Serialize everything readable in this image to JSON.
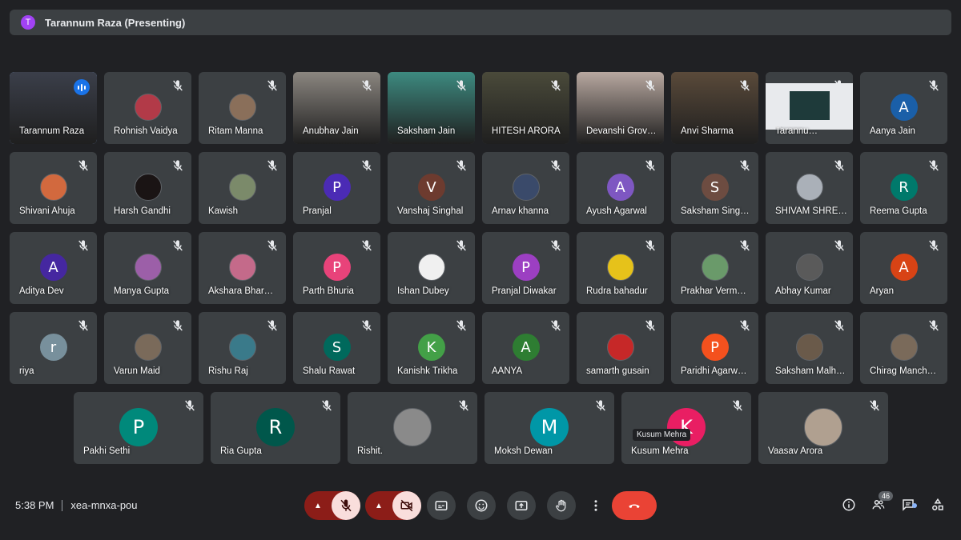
{
  "presenter": {
    "initial": "T",
    "label": "Tarannum Raza (Presenting)"
  },
  "rows": [
    [
      {
        "name": "Tarannum Raza",
        "type": "video",
        "bg": "#3b3f4a",
        "speaking": true
      },
      {
        "name": "Rohnish Vaidya",
        "type": "photo",
        "bg": "#b23a48"
      },
      {
        "name": "Ritam Manna",
        "type": "photo",
        "bg": "#8a6f5a"
      },
      {
        "name": "Anubhav Jain",
        "type": "video",
        "bg": "#8b8680"
      },
      {
        "name": "Saksham Jain",
        "type": "video",
        "bg": "#3d8a80"
      },
      {
        "name": "HITESH ARORA",
        "type": "video",
        "bg": "#4a4a3a"
      },
      {
        "name": "Devanshi Grov…",
        "type": "video",
        "bg": "#b8a8a0"
      },
      {
        "name": "Anvi Sharma",
        "type": "video",
        "bg": "#5a4a3a"
      },
      {
        "name": "Tarannu…",
        "type": "screen",
        "bg": "#e8eaed"
      },
      {
        "name": "Aanya Jain",
        "type": "initial",
        "initial": "A",
        "bg": "#1a5fa8"
      }
    ],
    [
      {
        "name": "Shivani Ahuja",
        "type": "photo",
        "bg": "#d2693e"
      },
      {
        "name": "Harsh Gandhi",
        "type": "photo",
        "bg": "#1a1414"
      },
      {
        "name": "Kawish",
        "type": "photo",
        "bg": "#7b8a6a"
      },
      {
        "name": "Pranjal",
        "type": "initial",
        "initial": "P",
        "bg": "#4b2bb5"
      },
      {
        "name": "Vanshaj Singhal",
        "type": "initial",
        "initial": "V",
        "bg": "#6d3b2f"
      },
      {
        "name": "Arnav khanna",
        "type": "photo",
        "bg": "#3a4a6a"
      },
      {
        "name": "Ayush Agarwal",
        "type": "initial",
        "initial": "A",
        "bg": "#7e57c2"
      },
      {
        "name": "Saksham Sing…",
        "type": "initial",
        "initial": "S",
        "bg": "#6d4c41"
      },
      {
        "name": "SHIVAM SHRE…",
        "type": "photo",
        "bg": "#aab0b8"
      },
      {
        "name": "Reema Gupta",
        "type": "initial",
        "initial": "R",
        "bg": "#00796b"
      }
    ],
    [
      {
        "name": "Aditya Dev",
        "type": "initial",
        "initial": "A",
        "bg": "#4527a0"
      },
      {
        "name": "Manya Gupta",
        "type": "photo",
        "bg": "#9c5fa8"
      },
      {
        "name": "Akshara Bhar…",
        "type": "photo",
        "bg": "#c46a8a"
      },
      {
        "name": "Parth Bhuria",
        "type": "initial",
        "initial": "P",
        "bg": "#e8437a"
      },
      {
        "name": "Ishan Dubey",
        "type": "photo",
        "bg": "#f0f0f0"
      },
      {
        "name": "Pranjal Diwakar",
        "type": "initial",
        "initial": "P",
        "bg": "#9c3fc2"
      },
      {
        "name": "Rudra bahadur",
        "type": "photo",
        "bg": "#e6c21a"
      },
      {
        "name": "Prakhar Verm…",
        "type": "photo",
        "bg": "#6a9a6a"
      },
      {
        "name": "Abhay Kumar",
        "type": "photo",
        "bg": "#5a5a5a"
      },
      {
        "name": "Aryan",
        "type": "initial",
        "initial": "A",
        "bg": "#d84315"
      }
    ],
    [
      {
        "name": "riya",
        "type": "initial",
        "initial": "r",
        "bg": "#78909c"
      },
      {
        "name": "Varun Maid",
        "type": "photo",
        "bg": "#7a6a5a"
      },
      {
        "name": "Rishu Raj",
        "type": "photo",
        "bg": "#3a7a8a"
      },
      {
        "name": "Shalu Rawat",
        "type": "initial",
        "initial": "S",
        "bg": "#00695c"
      },
      {
        "name": "Kanishk Trikha",
        "type": "initial",
        "initial": "K",
        "bg": "#43a047"
      },
      {
        "name": "AANYA",
        "type": "initial",
        "initial": "A",
        "bg": "#2e7d32"
      },
      {
        "name": "samarth gusain",
        "type": "photo",
        "bg": "#c62828"
      },
      {
        "name": "Paridhi Agarw…",
        "type": "initial",
        "initial": "P",
        "bg": "#f4511e"
      },
      {
        "name": "Saksham Malh…",
        "type": "photo",
        "bg": "#6a5a4a"
      },
      {
        "name": "Chirag Manch…",
        "type": "photo",
        "bg": "#7a6a5a"
      }
    ],
    [
      {
        "name": "Pakhi Sethi",
        "type": "initial",
        "initial": "P",
        "bg": "#00897b"
      },
      {
        "name": "Ria Gupta",
        "type": "initial",
        "initial": "R",
        "bg": "#00574b"
      },
      {
        "name": "Rishit.",
        "type": "photo",
        "bg": "#8a8a8a"
      },
      {
        "name": "Moksh Dewan",
        "type": "initial",
        "initial": "M",
        "bg": "#0097a7"
      },
      {
        "name": "Kusum Mehra",
        "type": "initial",
        "initial": "K",
        "bg": "#e91e63"
      },
      {
        "name": "Vaasav Arora",
        "type": "photo",
        "bg": "#b0a090"
      }
    ]
  ],
  "tooltip": "Kusum Mehra",
  "bottom": {
    "time": "5:38 PM",
    "meeting_code": "xea-mnxa-pou",
    "participant_count": "46"
  },
  "colors": {
    "background": "#202124",
    "tile": "#3c4043",
    "accent": "#8ab4f8",
    "end_call": "#ea4335",
    "muted_ctrl": "#8c1d18"
  }
}
